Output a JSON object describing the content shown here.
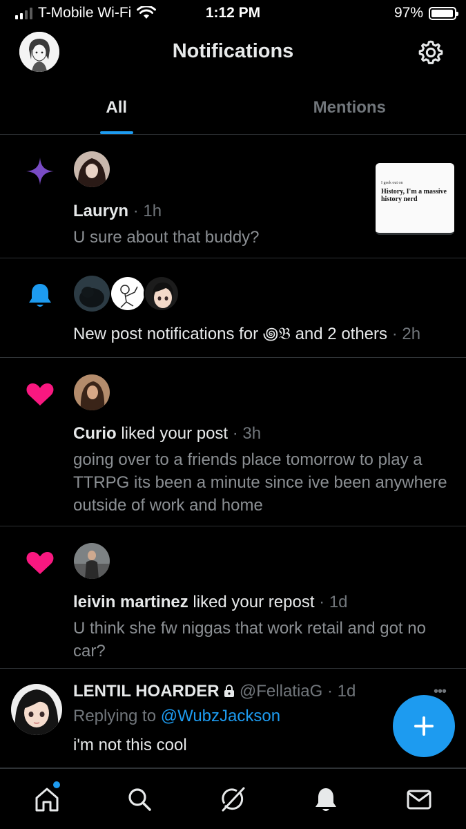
{
  "status_bar": {
    "carrier": "T-Mobile Wi-Fi",
    "time": "1:12 PM",
    "battery": "97%",
    "battery_level": 0.97
  },
  "header": {
    "title": "Notifications"
  },
  "tabs": [
    {
      "label": "All",
      "active": true
    },
    {
      "label": "Mentions",
      "active": false
    }
  ],
  "notifications": [
    {
      "type": "recommendation",
      "icon": "sparkle-icon",
      "name": "Lauryn",
      "time": "· 1h",
      "body": "U sure about that buddy?",
      "preview": {
        "small": "I geek out on",
        "big": "History, I'm a massive history nerd"
      }
    },
    {
      "type": "post-notification",
      "icon": "bell-icon",
      "text": "New post notifications for ꩜𝔅 and 2 others",
      "time": "· 2h"
    },
    {
      "type": "like",
      "icon": "heart-icon",
      "name": "Curio",
      "action": " liked your post",
      "time": " · 3h",
      "body": "going over to a friends place tomorrow to play a TTRPG its been a minute since ive been anywhere outside of work and home"
    },
    {
      "type": "like",
      "icon": "heart-icon",
      "name": "leivin martinez",
      "action": " liked your repost",
      "time": " · 1d",
      "body": "U think she fw niggas that work retail and got no car?"
    },
    {
      "type": "reply",
      "name": "LENTIL HOARDER",
      "handle": "@FellatiaG",
      "time": "· 1d",
      "replying_prefix": "Replying to ",
      "replying_to": "@WubzJackson",
      "body": "i'm not this cool"
    }
  ],
  "bottom_nav": [
    "home-icon",
    "search-icon",
    "grok-icon",
    "notifications-icon",
    "messages-icon"
  ],
  "colors": {
    "accent": "#1d9bf0",
    "heart": "#f91880",
    "sparkle": "#794bc4",
    "muted": "#71767b"
  }
}
